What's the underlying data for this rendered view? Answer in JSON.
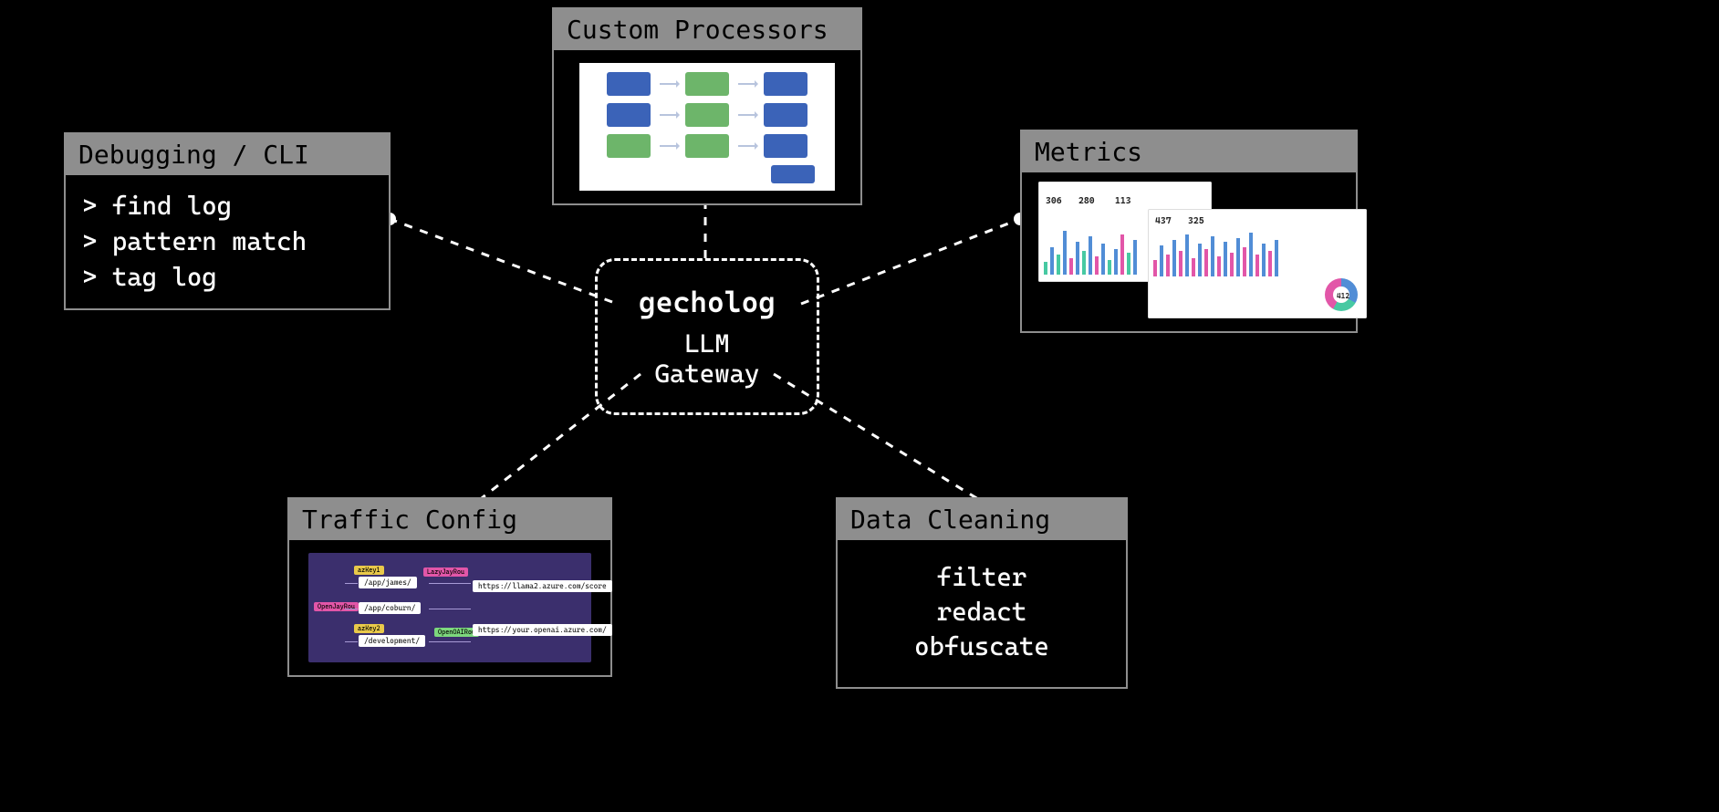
{
  "hub": {
    "title": "gecholog",
    "subtitle": "LLM Gateway"
  },
  "cards": {
    "debugging": {
      "title": "Debugging / CLI",
      "lines": [
        "> find log",
        "> pattern match",
        "> tag log"
      ]
    },
    "custom_processors": {
      "title": "Custom Processors"
    },
    "metrics": {
      "title": "Metrics",
      "kpis": [
        "306",
        "280",
        "113",
        "437",
        "325",
        "412"
      ]
    },
    "traffic_config": {
      "title": "Traffic Config",
      "routes": {
        "keys": [
          "azKey1",
          "azKey2"
        ],
        "paths": [
          "/app/james/",
          "/app/coburn/",
          "/development/"
        ],
        "targets": [
          "https://llama2.azure.com/score",
          "https://your.openai.azure.com/"
        ],
        "badges": [
          "LazyJayRou",
          "OpenJayRou",
          "OpenOAIRou"
        ]
      }
    },
    "data_cleaning": {
      "title": "Data Cleaning",
      "lines": [
        "filter",
        "redact",
        "obfuscate"
      ]
    }
  }
}
